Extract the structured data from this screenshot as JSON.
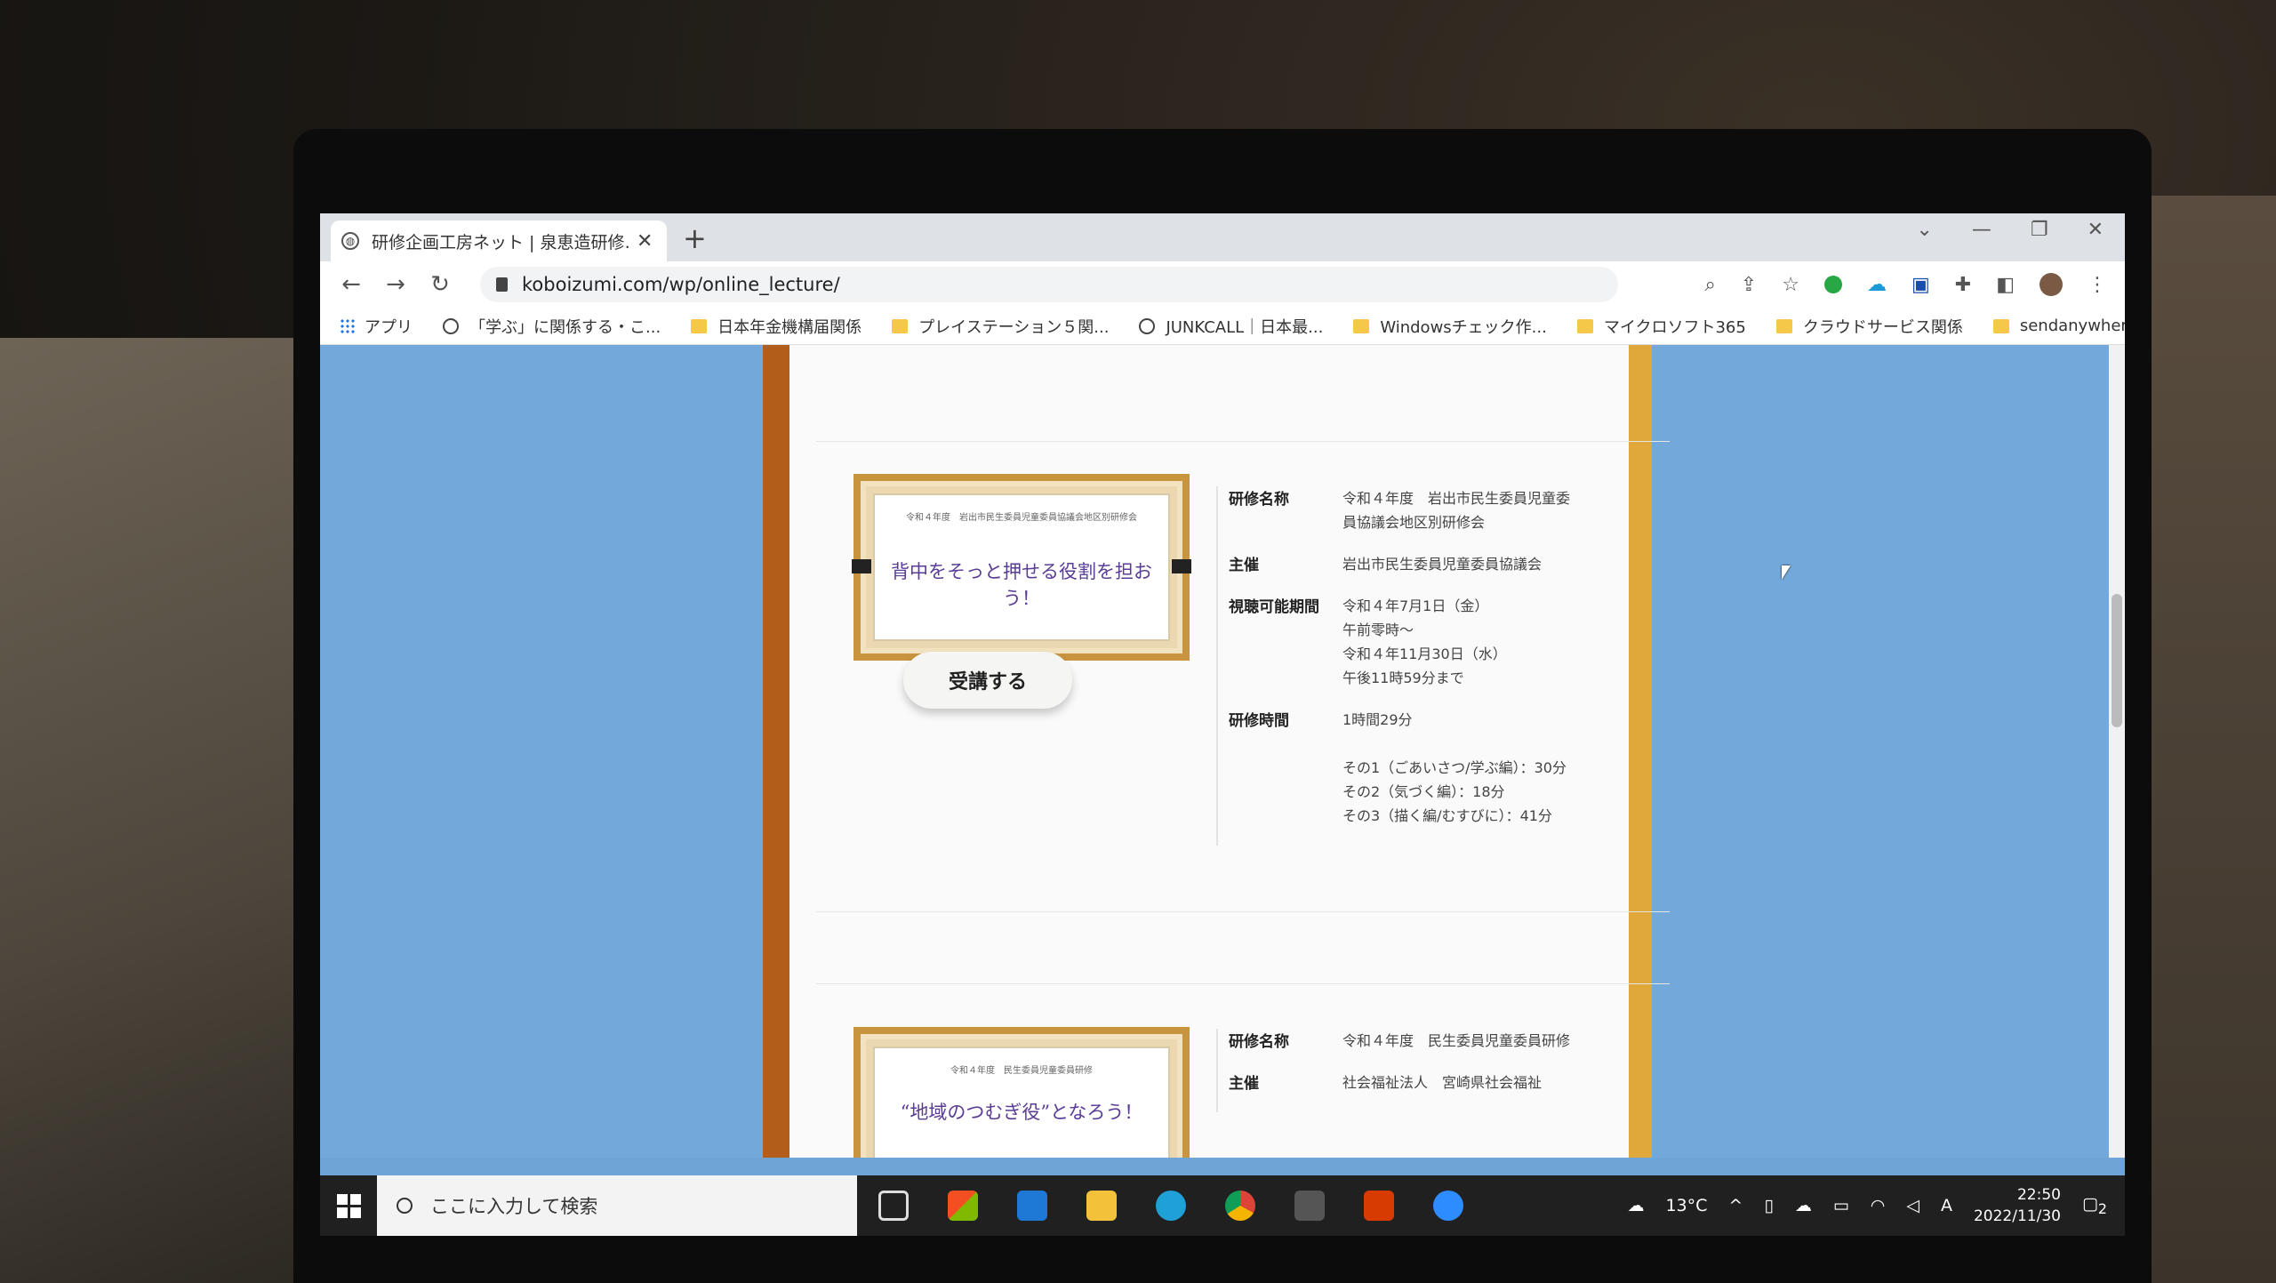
{
  "browser": {
    "tab_title": "研修企画工房ネット | 泉恵造研修…",
    "url": "koboizumi.com/wp/online_lecture/",
    "bookmarks": [
      "アプリ",
      "「学ぶ」に関係する・こ...",
      "日本年金機構届関係",
      "プレイステーション５関...",
      "JUNKCALL｜日本最...",
      "Windowsチェック作...",
      "マイクロソフト365",
      "クラウドサービス関係",
      "sendanywhere"
    ],
    "more": "»"
  },
  "course1": {
    "thumb_small": "令和４年度　岩出市民生委員児童委員協議会地区別研修会",
    "thumb_big": "背中をそっと押せる役割を担おう！",
    "enroll_label": "受講する",
    "rows": [
      {
        "label": "研修名称",
        "value": "令和４年度　岩出市民生委員児童委員協議会地区別研修会"
      },
      {
        "label": "主催",
        "value": "岩出市民生委員児童委員協議会"
      },
      {
        "label": "視聴可能期間",
        "value": "令和４年7月1日（金）\n午前零時～\n令和４年11月30日（水）\n午後11時59分まで"
      },
      {
        "label": "研修時間",
        "value": "1時間29分\n\nその1（ごあいさつ/学ぶ編）：30分\nその2（気づく編）：18分\nその3（描く編/むすびに）：41分"
      }
    ]
  },
  "course2": {
    "thumb_small": "令和４年度　民生委員児童委員研修",
    "thumb_big": "“地域のつむぎ役”となろう！",
    "rows": [
      {
        "label": "研修名称",
        "value": "令和４年度　民生委員児童委員研修"
      },
      {
        "label": "主催",
        "value": "社会福祉法人　宮崎県社会福祉"
      }
    ]
  },
  "taskbar": {
    "search_placeholder": "ここに入力して検索",
    "weather": "13°C",
    "ime": "A",
    "time": "22:50",
    "date": "2022/11/30",
    "notif": "2"
  }
}
